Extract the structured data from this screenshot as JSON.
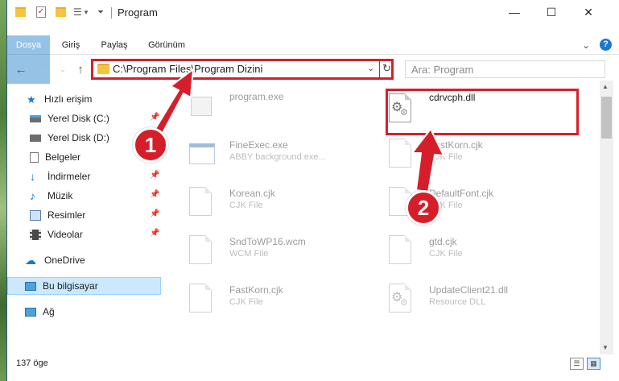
{
  "window": {
    "title": "Program",
    "minimize": "—",
    "maximize": "☐",
    "close": "✕"
  },
  "ribbon": {
    "tabs": [
      "Dosya",
      "Giriş",
      "Paylaş",
      "Görünüm"
    ],
    "expand": "⌄",
    "help": "?"
  },
  "address": {
    "path": "C:\\Program Files\\Program Dizini",
    "search_placeholder": "Ara: Program"
  },
  "sidebar": {
    "items": [
      {
        "label": "Hızlı erişim"
      },
      {
        "label": "Yerel Disk (C:)"
      },
      {
        "label": "Yerel Disk (D:)"
      },
      {
        "label": "Belgeler"
      },
      {
        "label": "İndirmeler"
      },
      {
        "label": "Müzik"
      },
      {
        "label": "Resimler"
      },
      {
        "label": "Videolar"
      },
      {
        "label": "OneDrive"
      },
      {
        "label": "Bu bilgisayar"
      },
      {
        "label": "Ağ"
      }
    ]
  },
  "files": [
    {
      "name": "program.exe",
      "type": ""
    },
    {
      "name": "cdrvcph.dll",
      "type": ""
    },
    {
      "name": "FineExec.exe",
      "type": "ABBY background exe..."
    },
    {
      "name": "FastKorn.cjk",
      "type": "CJK File"
    },
    {
      "name": "Korean.cjk",
      "type": "CJK File"
    },
    {
      "name": "DefaultFont.cjk",
      "type": "CJK File"
    },
    {
      "name": "SndToWP16.wcm",
      "type": "WCM File"
    },
    {
      "name": "gtd.cjk",
      "type": "CJK File"
    },
    {
      "name": "FastKorn.cjk",
      "type": "CJK File"
    },
    {
      "name": "UpdateClient21.dll",
      "type": "Resource DLL"
    }
  ],
  "status": {
    "count": "137 öge"
  },
  "steps": [
    "1",
    "2"
  ],
  "colors": {
    "accent": "#1979ca",
    "highlight": "#d61e2b"
  }
}
